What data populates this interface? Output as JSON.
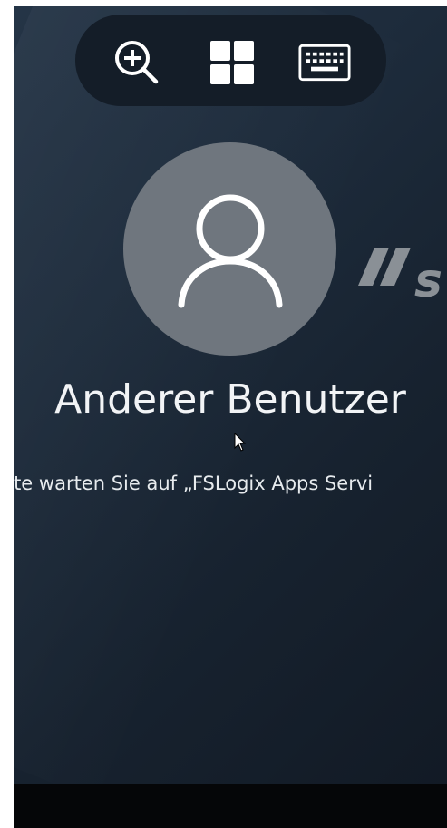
{
  "toolbar": {
    "buttons": [
      {
        "name": "zoom-in",
        "icon": "magnifier-plus-icon"
      },
      {
        "name": "windows",
        "icon": "windows-logo-icon"
      },
      {
        "name": "keyboard",
        "icon": "keyboard-icon"
      }
    ]
  },
  "account": {
    "name": "Anderer Benutzer",
    "avatar_icon": "user-silhouette-icon"
  },
  "status": {
    "message": "itte warten Sie auf „FSLogix Apps Servi"
  },
  "logo": {
    "fragment": "//s"
  },
  "colors": {
    "background": "#1d2b3b",
    "avatar": "#6f767e",
    "text": "#f2f4f6",
    "toolbar": "#141d28",
    "logo": "#8a9096"
  }
}
